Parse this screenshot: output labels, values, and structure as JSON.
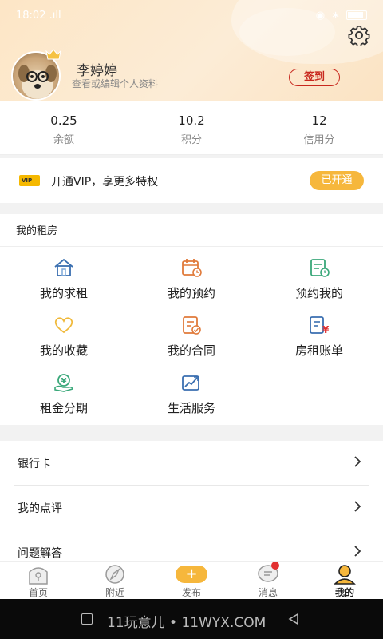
{
  "status_bar": {
    "time": "18:02",
    "signal": ".ıll"
  },
  "profile": {
    "username": "李婷婷",
    "subtitle": "查看或编辑个人资料",
    "signin_label": "签到"
  },
  "stats": [
    {
      "value": "0.25",
      "label": "余额"
    },
    {
      "value": "10.2",
      "label": "积分"
    },
    {
      "value": "12",
      "label": "信用分"
    }
  ],
  "vip": {
    "card_text": "VIP",
    "text": "开通VIP，享更多特权",
    "button": "已开通"
  },
  "rent_section": {
    "title": "我的租房",
    "items": [
      {
        "label": "我的求租",
        "icon": "house-icon"
      },
      {
        "label": "我的预约",
        "icon": "calendar-clock-icon"
      },
      {
        "label": "预约我的",
        "icon": "document-clock-icon"
      },
      {
        "label": "我的收藏",
        "icon": "heart-icon"
      },
      {
        "label": "我的合同",
        "icon": "contract-icon"
      },
      {
        "label": "房租账单",
        "icon": "bill-yen-icon"
      },
      {
        "label": "租金分期",
        "icon": "yen-coin-hand-icon"
      },
      {
        "label": "生活服务",
        "icon": "trend-chart-icon"
      }
    ]
  },
  "list": [
    {
      "label": "银行卡"
    },
    {
      "label": "我的点评"
    },
    {
      "label": "问题解答"
    }
  ],
  "tabs": [
    {
      "label": "首页",
      "icon": "home-tab-icon"
    },
    {
      "label": "附近",
      "icon": "compass-icon"
    },
    {
      "label": "发布",
      "icon": "plus-icon",
      "glyph": "+"
    },
    {
      "label": "消息",
      "icon": "message-icon"
    },
    {
      "label": "我的",
      "icon": "user-icon"
    }
  ],
  "system_bar": {
    "watermark": "11玩意儿 • 11WYX.COM"
  },
  "colors": {
    "accent": "#f6b73c",
    "signin": "#c8281e",
    "icon_blue": "#3a6fb0",
    "icon_orange": "#e07a3a",
    "icon_green": "#3aa87a"
  }
}
